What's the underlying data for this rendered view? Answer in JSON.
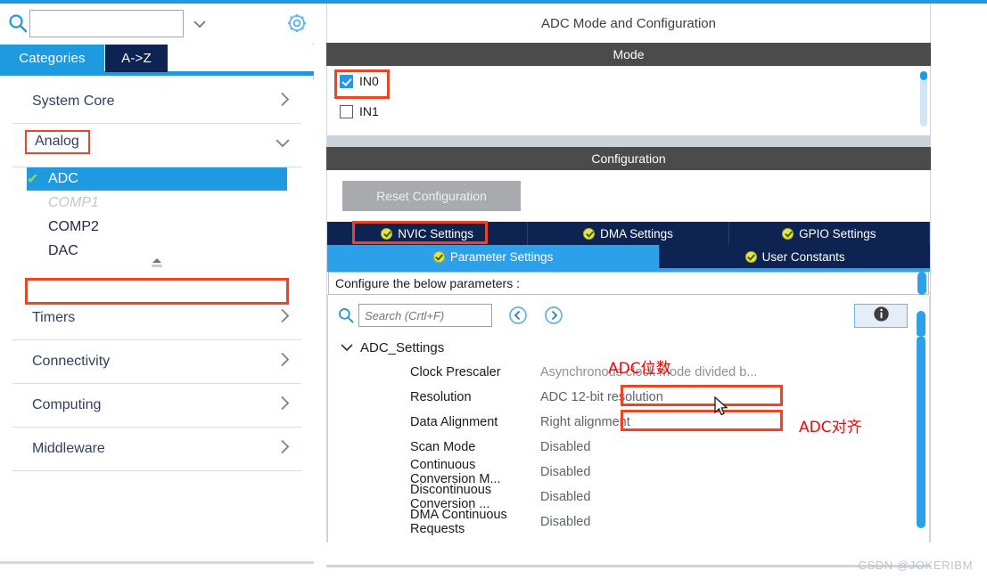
{
  "window": {
    "accent_color": "#1e9ae0",
    "watermark": "CSDN @JOKERIBM"
  },
  "sidebar": {
    "search": {
      "value": "",
      "placeholder": "",
      "icon": "search-icon",
      "dropdown_icon": "chevron-down-icon"
    },
    "settings_icon": "gear-icon",
    "tabs": [
      {
        "label": "Categories",
        "active": true
      },
      {
        "label": "A->Z",
        "active": false
      }
    ],
    "categories": [
      {
        "label": "System Core",
        "expanded": false,
        "arrow": "›",
        "highlighted": false
      },
      {
        "label": "Analog",
        "expanded": true,
        "arrow": "∨",
        "highlighted": true
      },
      {
        "label": "Timers",
        "expanded": false,
        "arrow": "›",
        "highlighted": false
      },
      {
        "label": "Connectivity",
        "expanded": false,
        "arrow": "›",
        "highlighted": false
      },
      {
        "label": "Computing",
        "expanded": false,
        "arrow": "›",
        "highlighted": false
      },
      {
        "label": "Middleware",
        "expanded": false,
        "arrow": "›",
        "highlighted": false
      }
    ],
    "analog_items": [
      {
        "label": "ADC",
        "selected": true,
        "disabled": false,
        "check": "✔"
      },
      {
        "label": "COMP1",
        "selected": false,
        "disabled": true,
        "check": ""
      },
      {
        "label": "COMP2",
        "selected": false,
        "disabled": false,
        "check": ""
      },
      {
        "label": "DAC",
        "selected": false,
        "disabled": false,
        "check": ""
      }
    ]
  },
  "main": {
    "title": "ADC Mode and Configuration",
    "mode_section": {
      "header": "Mode",
      "channels": [
        {
          "label": "IN0",
          "checked": true,
          "highlighted": true
        },
        {
          "label": "IN1",
          "checked": false,
          "highlighted": false
        }
      ]
    },
    "configuration_section": {
      "header": "Configuration",
      "reset_button": "Reset Configuration",
      "tabs_row1": [
        {
          "label": "NVIC Settings",
          "active": false,
          "highlighted": true,
          "icon": "check-circle-icon"
        },
        {
          "label": "DMA Settings",
          "active": false,
          "highlighted": false,
          "icon": "check-circle-icon"
        },
        {
          "label": "GPIO Settings",
          "active": false,
          "highlighted": false,
          "icon": "check-circle-icon"
        }
      ],
      "tabs_row2": [
        {
          "label": "Parameter Settings",
          "active": true,
          "highlighted": false,
          "icon": "check-circle-icon"
        },
        {
          "label": "User Constants",
          "active": false,
          "highlighted": false,
          "icon": "check-circle-icon"
        }
      ],
      "note": "Configure the below parameters :",
      "param_search": {
        "value": "",
        "placeholder": "Search (Crtl+F)",
        "icon": "search-icon"
      },
      "nav_prev_icon": "chevron-left-circle-icon",
      "nav_next_icon": "chevron-right-circle-icon",
      "info_button_icon": "info-icon",
      "group_label": "ADC_Settings",
      "group_expanded": true,
      "parameters": [
        {
          "name": "Clock Prescaler",
          "value": "Asynchronous clock mode divided b...",
          "highlighted": false
        },
        {
          "name": "Resolution",
          "value": "ADC 12-bit resolution",
          "highlighted": true
        },
        {
          "name": "Data Alignment",
          "value": "Right alignment",
          "highlighted": true
        },
        {
          "name": "Scan Mode",
          "value": "Disabled",
          "highlighted": false
        },
        {
          "name": "Continuous Conversion M...",
          "value": "Disabled",
          "highlighted": false
        },
        {
          "name": "Discontinuous Conversion ...",
          "value": "Disabled",
          "highlighted": false
        },
        {
          "name": "DMA Continuous Requests",
          "value": "Disabled",
          "highlighted": false
        }
      ]
    }
  },
  "annotations": [
    {
      "text": "ADC位数",
      "color": "#ff0000"
    },
    {
      "text": "ADC对齐",
      "color": "#ff0000"
    }
  ]
}
